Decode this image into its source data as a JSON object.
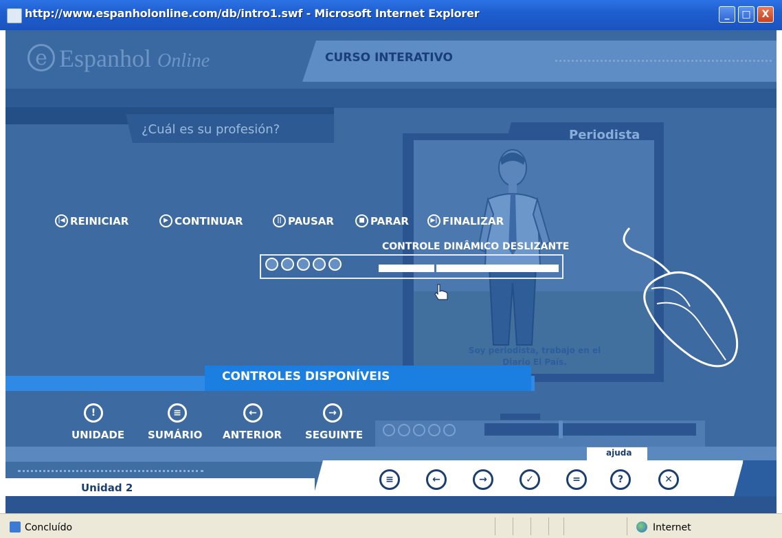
{
  "window": {
    "title": "http://www.espanholonline.com/db/intro1.swf - Microsoft Internet Explorer",
    "minimize": "_",
    "maximize": "□",
    "close": "X"
  },
  "header": {
    "logo_mark": "e",
    "logo_text": "Espanhol",
    "logo_script": "Online",
    "course_tab": "CURSO INTERATIVO"
  },
  "question": "¿Cuál es su profesión?",
  "card": {
    "title": "Periodista",
    "caption": "Soy periodista, trabajo en el Diario El País."
  },
  "playback_controls": [
    {
      "icon": "restart-icon",
      "glyph": "|◀",
      "label": "REINICIAR"
    },
    {
      "icon": "play-icon",
      "glyph": "▶",
      "label": "CONTINUAR"
    },
    {
      "icon": "pause-icon",
      "glyph": "||",
      "label": "PAUSAR"
    },
    {
      "icon": "stop-icon",
      "glyph": "■",
      "label": "PARAR"
    },
    {
      "icon": "end-icon",
      "glyph": "▶|",
      "label": "FINALIZAR"
    }
  ],
  "slider": {
    "label": "CONTROLE DINÂMICO DESLIZANTE",
    "position": 0.31
  },
  "controls_panel": {
    "title": "CONTROLES DISPONÍVEIS",
    "buttons": [
      {
        "icon": "unit-icon",
        "glyph": "!",
        "label": "UNIDADE"
      },
      {
        "icon": "summary-icon",
        "glyph": "≡",
        "label": "SUMÁRIO"
      },
      {
        "icon": "arrow-left-icon",
        "glyph": "←",
        "label": "ANTERIOR"
      },
      {
        "icon": "arrow-right-icon",
        "glyph": "→",
        "label": "SEGUINTE"
      }
    ]
  },
  "footer": {
    "unit_label": "Unidad 2",
    "help_label": "ajuda",
    "nav_icons": [
      {
        "icon": "menu-icon",
        "glyph": "≡"
      },
      {
        "icon": "arrow-left-icon",
        "glyph": "←"
      },
      {
        "icon": "arrow-right-icon",
        "glyph": "→"
      },
      {
        "icon": "check-icon",
        "glyph": "✓"
      },
      {
        "icon": "notes-icon",
        "glyph": "="
      },
      {
        "icon": "help-icon",
        "glyph": "?"
      },
      {
        "icon": "close-icon",
        "glyph": "✕"
      }
    ]
  },
  "statusbar": {
    "status": "Concluído",
    "zone": "Internet"
  },
  "colors": {
    "stage_bg": "#3d6ba1",
    "accent_blue": "#1a7fe0",
    "titlebar": "#1f5fd0"
  }
}
